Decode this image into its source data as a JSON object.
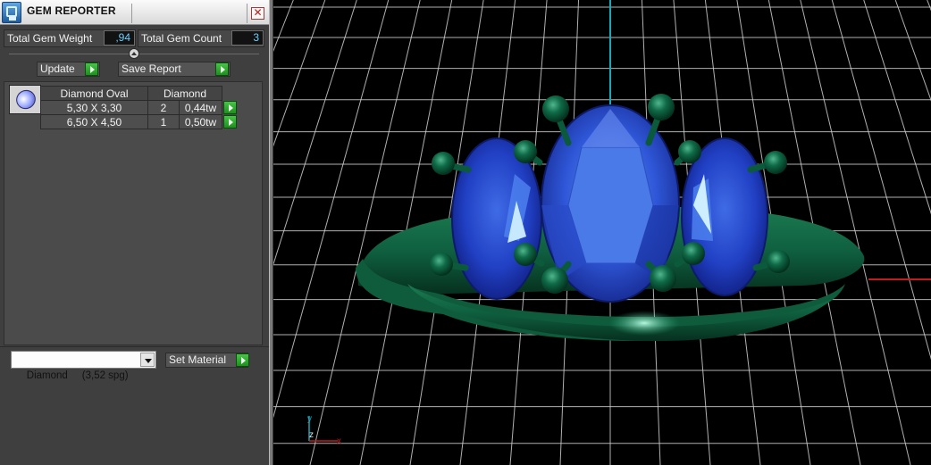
{
  "window": {
    "title": "GEM REPORTER",
    "close_label": "✕"
  },
  "summary": {
    "weight_label": "Total Gem Weight",
    "weight_value": ",94",
    "count_label": "Total Gem Count",
    "count_value": "3"
  },
  "toolbar": {
    "update_label": "Update",
    "save_label": "Save Report"
  },
  "gem_table": {
    "headers": [
      "Diamond Oval",
      "Diamond"
    ],
    "rows": [
      {
        "size": "5,30 X 3,30",
        "count": "2",
        "weight": "0,44tw"
      },
      {
        "size": "6,50 X 4,50",
        "count": "1",
        "weight": "0,50tw"
      }
    ]
  },
  "material": {
    "selected": "Diamond     (3,52 spg)",
    "set_label": "Set Material"
  },
  "viewport": {
    "axis_labels": {
      "y": "y",
      "z": "z",
      "x": "x"
    },
    "colors": {
      "gem": "#2340c8",
      "metal": "#0f6a44",
      "prong": "#0c5a3c",
      "grid": "#cfcfcf",
      "y_axis": "#1aa7b8",
      "x_axis": "#c01e1e"
    }
  }
}
